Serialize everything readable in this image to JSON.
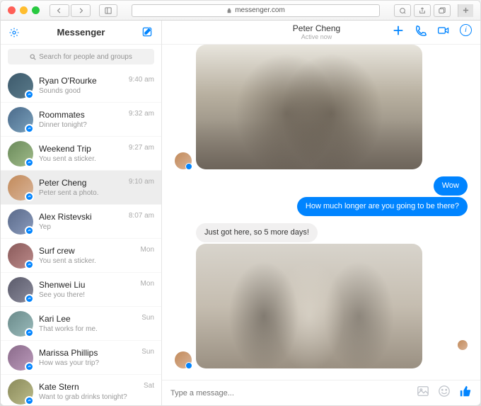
{
  "browser": {
    "url": "messenger.com"
  },
  "sidebar": {
    "title": "Messenger",
    "search_placeholder": "Search for people and groups",
    "items": [
      {
        "name": "Ryan O'Rourke",
        "preview": "Sounds good",
        "time": "9:40 am"
      },
      {
        "name": "Roommates",
        "preview": "Dinner tonight?",
        "time": "9:32 am"
      },
      {
        "name": "Weekend Trip",
        "preview": "You sent a sticker.",
        "time": "9:27 am"
      },
      {
        "name": "Peter Cheng",
        "preview": "Peter sent a photo.",
        "time": "9:10 am"
      },
      {
        "name": "Alex Ristevski",
        "preview": "Yep",
        "time": "8:07 am"
      },
      {
        "name": "Surf crew",
        "preview": "You sent a sticker.",
        "time": "Mon"
      },
      {
        "name": "Shenwei Liu",
        "preview": "See you there!",
        "time": "Mon"
      },
      {
        "name": "Kari Lee",
        "preview": "That works for me.",
        "time": "Sun"
      },
      {
        "name": "Marissa Phillips",
        "preview": "How was your trip?",
        "time": "Sun"
      },
      {
        "name": "Kate Stern",
        "preview": "Want to grab drinks tonight?",
        "time": "Sat"
      }
    ]
  },
  "conversation": {
    "name": "Peter Cheng",
    "status": "Active now",
    "messages": {
      "mine1": "Wow",
      "mine2": "How much longer are you going to be there?",
      "theirs1": "Just got here, so 5 more days!"
    }
  },
  "composer": {
    "placeholder": "Type a message..."
  }
}
